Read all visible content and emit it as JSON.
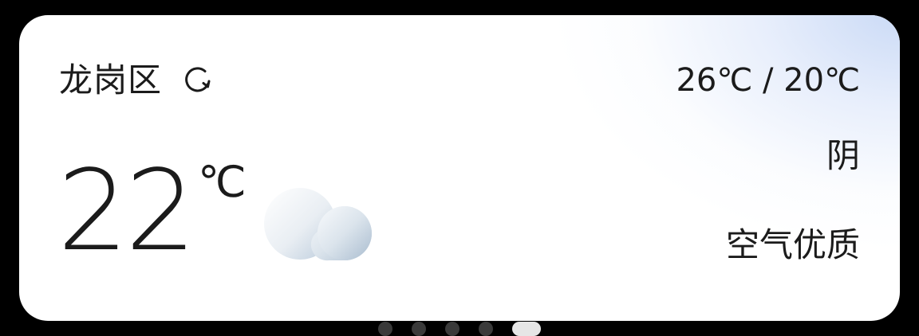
{
  "weather": {
    "location": "龙岗区",
    "refresh_icon": "refresh-icon",
    "current_temp": "22",
    "temp_unit": "℃",
    "condition_icon": "cloud-icon",
    "temp_range": "26℃ / 20℃",
    "condition": "阴",
    "air_quality_label": "空气优质"
  },
  "pager": {
    "total_pages": 5,
    "active_index": 4
  },
  "colors": {
    "background": "#000000",
    "card": "#ffffff",
    "card_glow": "#c6d7f5",
    "text": "#1b1b1b",
    "dot_inactive": "#3a3a3a",
    "dot_active": "#e6e6e6"
  }
}
